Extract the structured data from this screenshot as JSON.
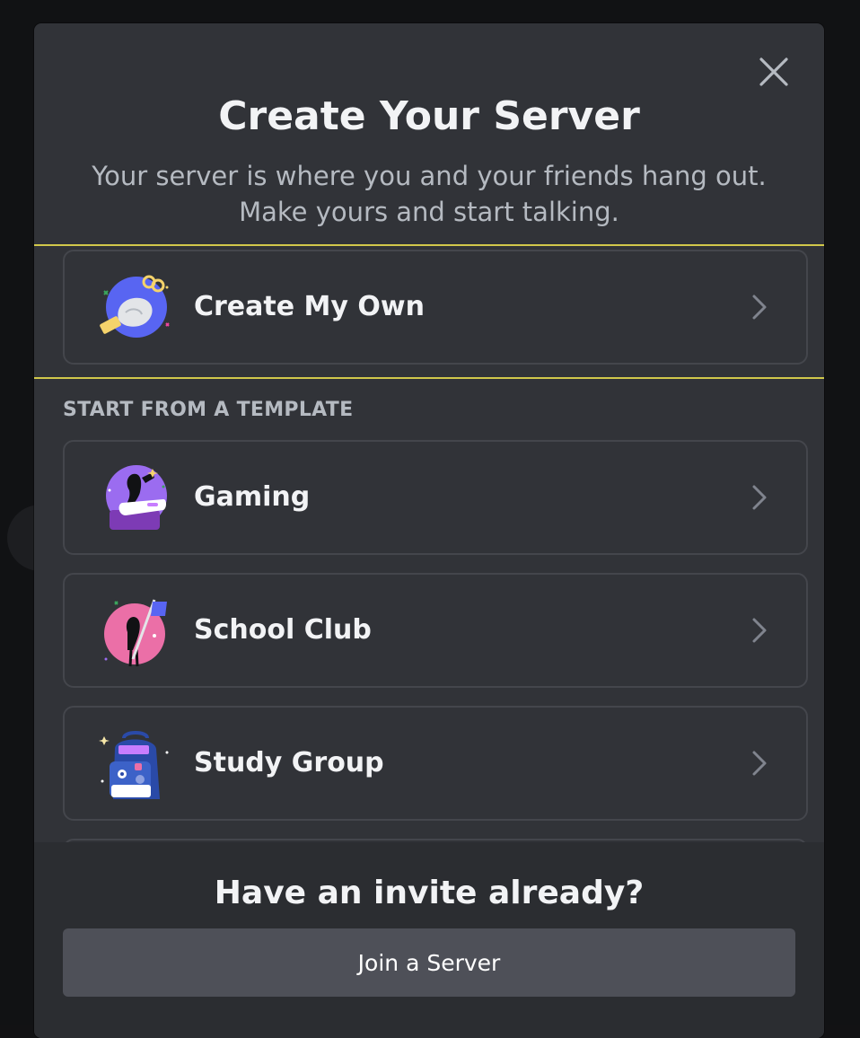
{
  "modal": {
    "title": "Create Your Server",
    "subtitle": "Your server is where you and your friends hang out. Make yours and start talking."
  },
  "options": {
    "create_own": {
      "label": "Create My Own",
      "icon": "create-server-illustration-icon"
    },
    "section_header": "START FROM A TEMPLATE",
    "templates": [
      {
        "label": "Gaming",
        "icon": "gaming-illustration-icon"
      },
      {
        "label": "School Club",
        "icon": "school-club-illustration-icon"
      },
      {
        "label": "Study Group",
        "icon": "study-group-illustration-icon"
      }
    ]
  },
  "footer": {
    "title": "Have an invite already?",
    "join_label": "Join a Server"
  },
  "colors": {
    "modal_bg": "#313338",
    "footer_bg": "#2b2d31",
    "text_primary": "#f2f3f5",
    "text_secondary": "#b5bac1",
    "button_bg": "#4e5058",
    "highlight": "#d1c84b"
  }
}
